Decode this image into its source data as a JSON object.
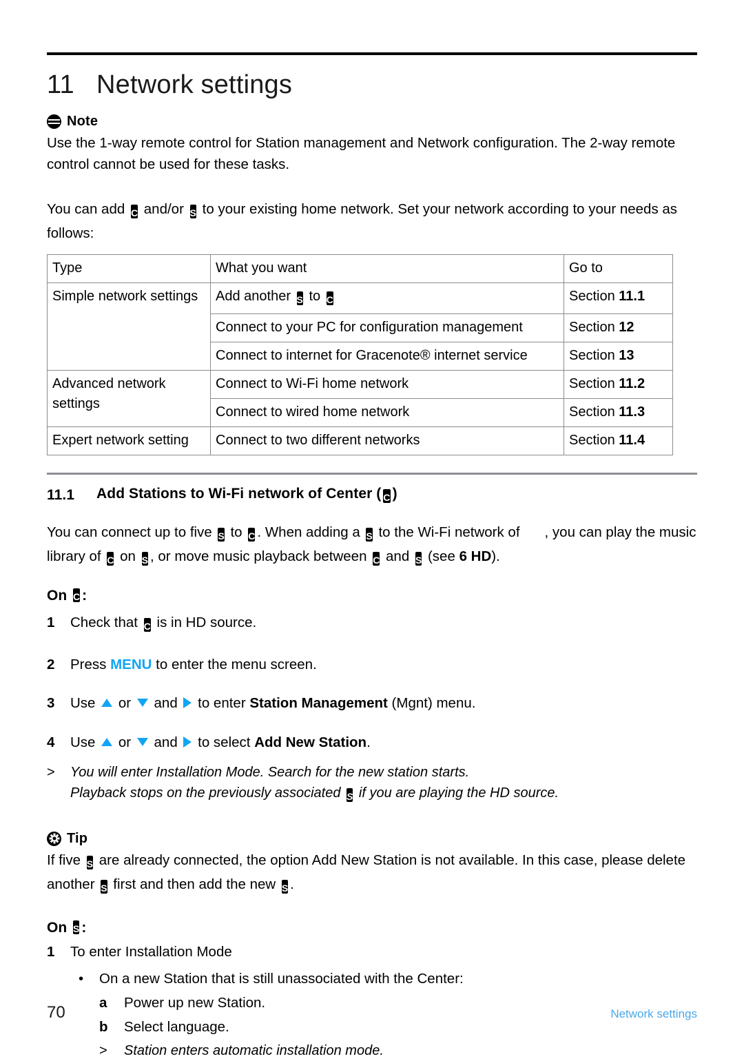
{
  "chapter": {
    "number": "11",
    "title": "Network settings"
  },
  "note": {
    "label": "Note",
    "icon": "note-icon",
    "text": "Use the 1-way remote control for Station management and Network configuration. The 2-way remote control cannot be used for these tasks."
  },
  "intro": {
    "part1": "You can add",
    "part2": "and/or",
    "part3": "to your existing home network. Set your network according to your needs as follows:"
  },
  "badges": {
    "center": "C",
    "station": "S"
  },
  "table": {
    "headers": {
      "type": "Type",
      "what": "What you want",
      "goto": "Go to"
    },
    "groups": [
      {
        "type": "Simple network settings",
        "rows": [
          {
            "what_pre": "Add another",
            "what_mid": "to",
            "what_post": "",
            "has_badges": true,
            "goto_label": "Section",
            "goto_num": "11.1"
          },
          {
            "what": "Connect to your PC for configuration management",
            "goto_label": "Section",
            "goto_num": "12"
          },
          {
            "what": "Connect to internet for Gracenote® internet service",
            "goto_label": "Section",
            "goto_num": "13"
          }
        ]
      },
      {
        "type": "Advanced network settings",
        "rows": [
          {
            "what": "Connect to Wi-Fi home network",
            "goto_label": "Section",
            "goto_num": "11.2"
          },
          {
            "what": "Connect to wired home network",
            "goto_label": "Section",
            "goto_num": "11.3"
          }
        ]
      },
      {
        "type": "Expert network setting",
        "rows": [
          {
            "what": "Connect to two different networks",
            "goto_label": "Section",
            "goto_num": "11.4"
          }
        ]
      }
    ]
  },
  "section": {
    "number": "11.1",
    "title_pre": "Add Stations to Wi-Fi network of Center (",
    "title_post": ")",
    "para": {
      "s1": "You can connect up to five",
      "s2": "to",
      "s3": ". When adding a",
      "s4": "to the Wi-Fi network of",
      "s5": ", you can play the music library of",
      "s6": "on",
      "s7": ", or move music playback between",
      "s8": "and",
      "s9": "(see",
      "s10": "6 HD",
      "s11": ")."
    }
  },
  "on_center": {
    "prefix": "On",
    "suffix": ":",
    "steps": [
      {
        "num": "1",
        "pre": "Check that",
        "post": "is in HD source."
      },
      {
        "num": "2",
        "pre": "Press",
        "key": "MENU",
        "post": "to enter the menu screen."
      },
      {
        "num": "3",
        "pre": "Use",
        "mid1": "or",
        "mid2": "and",
        "mid3": "to enter",
        "bold": "Station Management",
        "post": "(Mgnt) menu."
      },
      {
        "num": "4",
        "pre": "Use",
        "mid1": "or",
        "mid2": "and",
        "mid3": "to select",
        "bold": "Add New Station",
        "post": "."
      }
    ],
    "notes": {
      "marker": ">",
      "line1": "You will enter Installation Mode. Search for the new station starts.",
      "line2_pre": "Playback stops on the previously associated",
      "line2_post": "if you are playing the HD source."
    }
  },
  "tip": {
    "label": "Tip",
    "icon": "tip-icon",
    "pre": "If five",
    "mid": "are already connected, the option Add New Station is not available. In this case, please delete another",
    "mid2": "first and then add the new",
    "post": "."
  },
  "on_station": {
    "prefix": "On",
    "suffix": ":",
    "step1_num": "1",
    "step1_text": "To enter Installation Mode",
    "bullet_marker": "•",
    "bullet_text": "On a new Station that is still unassociated with the Center:",
    "sub_a_marker": "a",
    "sub_a_text": "Power up new Station.",
    "sub_b_marker": "b",
    "sub_b_text": "Select language.",
    "sub_note_marker": ">",
    "sub_note_text": "Station enters automatic installation mode."
  },
  "footer": {
    "page_number": "70",
    "title": "Network settings"
  },
  "colors": {
    "accent": "#12a5f4",
    "footer_accent": "#4aa8e8",
    "rule": "#000000",
    "gray_rule": "#8d8f92",
    "table_border": "#8b8b8b"
  }
}
